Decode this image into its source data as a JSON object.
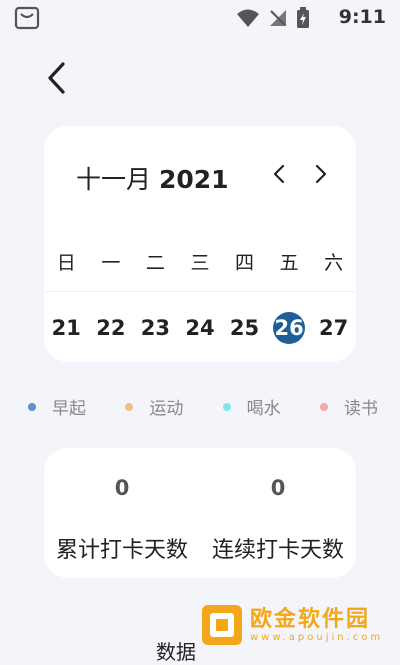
{
  "status_bar": {
    "time": "9:11"
  },
  "header": {
    "back_icon": "chevron-left-icon"
  },
  "calendar": {
    "month": "十一月",
    "year": "2021",
    "prev_icon": "chevron-left-icon",
    "next_icon": "chevron-right-icon",
    "weekdays": [
      "日",
      "一",
      "二",
      "三",
      "四",
      "五",
      "六"
    ],
    "dates": [
      "21",
      "22",
      "23",
      "24",
      "25",
      "26",
      "27"
    ],
    "selected_date": "26",
    "selected_color": "#1f5f98"
  },
  "legend": [
    {
      "label": "早起",
      "color": "#5b8fd0"
    },
    {
      "label": "运动",
      "color": "#f0c080"
    },
    {
      "label": "喝水",
      "color": "#7ce8e8"
    },
    {
      "label": "读书",
      "color": "#f0a8b0"
    }
  ],
  "stats": {
    "total": {
      "value": "0",
      "label": "累计打卡天数"
    },
    "streak": {
      "value": "0",
      "label": "连续打卡天数"
    }
  },
  "section_title": "数据",
  "watermark": {
    "main": "欧金软件园",
    "sub": "www.apoujin.com"
  }
}
